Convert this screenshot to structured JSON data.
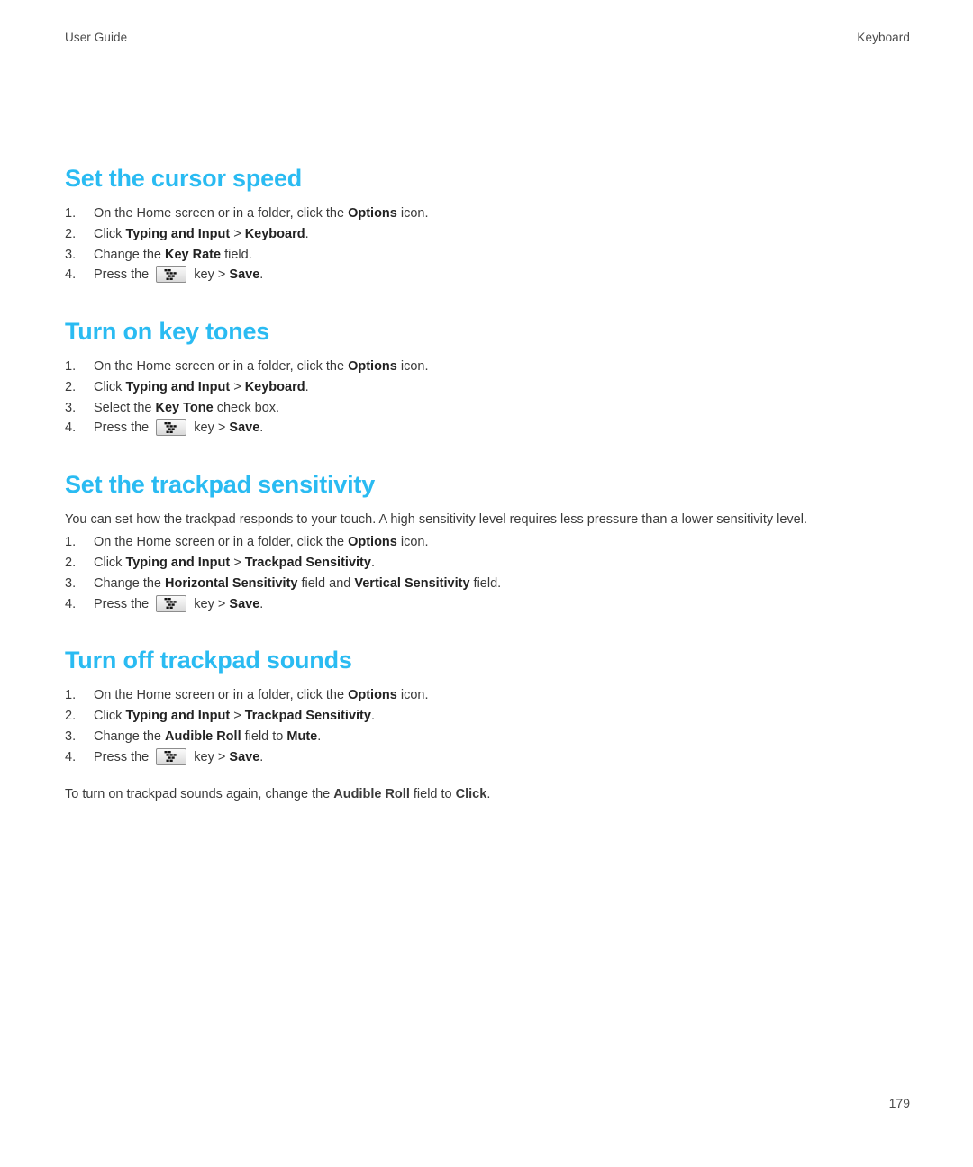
{
  "document": {
    "header": {
      "left": "User Guide",
      "right": "Keyboard"
    },
    "footer": {
      "page_number": "179"
    },
    "heading_color": "#2ABBF2",
    "key_icon_name": "blackberry-menu-key-icon"
  },
  "sections": [
    {
      "heading": "Set the cursor speed",
      "steps": [
        {
          "num": "1.",
          "parts": [
            {
              "t": "On the Home screen or in a folder, click the ",
              "b": false
            },
            {
              "t": "Options",
              "b": true
            },
            {
              "t": " icon.",
              "b": false
            }
          ]
        },
        {
          "num": "2.",
          "parts": [
            {
              "t": "Click ",
              "b": false
            },
            {
              "t": "Typing and Input",
              "b": true
            },
            {
              "t": " > ",
              "b": false
            },
            {
              "t": "Keyboard",
              "b": true
            },
            {
              "t": ".",
              "b": false
            }
          ]
        },
        {
          "num": "3.",
          "parts": [
            {
              "t": "Change the ",
              "b": false
            },
            {
              "t": "Key Rate",
              "b": true
            },
            {
              "t": " field.",
              "b": false
            }
          ]
        },
        {
          "num": "4.",
          "parts": [
            {
              "t": "Press the ",
              "b": false
            },
            {
              "icon": "blackberry-menu-key-icon"
            },
            {
              "t": " key > ",
              "b": false
            },
            {
              "t": "Save",
              "b": true
            },
            {
              "t": ".",
              "b": false
            }
          ]
        }
      ]
    },
    {
      "heading": "Turn on key tones",
      "steps": [
        {
          "num": "1.",
          "parts": [
            {
              "t": "On the Home screen or in a folder, click the ",
              "b": false
            },
            {
              "t": "Options",
              "b": true
            },
            {
              "t": " icon.",
              "b": false
            }
          ]
        },
        {
          "num": "2.",
          "parts": [
            {
              "t": "Click ",
              "b": false
            },
            {
              "t": "Typing and Input",
              "b": true
            },
            {
              "t": " > ",
              "b": false
            },
            {
              "t": "Keyboard",
              "b": true
            },
            {
              "t": ".",
              "b": false
            }
          ]
        },
        {
          "num": "3.",
          "parts": [
            {
              "t": "Select the ",
              "b": false
            },
            {
              "t": "Key Tone",
              "b": true
            },
            {
              "t": " check box.",
              "b": false
            }
          ]
        },
        {
          "num": "4.",
          "parts": [
            {
              "t": "Press the ",
              "b": false
            },
            {
              "icon": "blackberry-menu-key-icon"
            },
            {
              "t": " key > ",
              "b": false
            },
            {
              "t": "Save",
              "b": true
            },
            {
              "t": ".",
              "b": false
            }
          ]
        }
      ]
    },
    {
      "heading": "Set the trackpad sensitivity",
      "intro": "You can set how the trackpad responds to your touch. A high sensitivity level requires less pressure than a lower sensitivity level.",
      "steps": [
        {
          "num": "1.",
          "parts": [
            {
              "t": "On the Home screen or in a folder, click the ",
              "b": false
            },
            {
              "t": "Options",
              "b": true
            },
            {
              "t": " icon.",
              "b": false
            }
          ]
        },
        {
          "num": "2.",
          "parts": [
            {
              "t": "Click ",
              "b": false
            },
            {
              "t": "Typing and Input",
              "b": true
            },
            {
              "t": " > ",
              "b": false
            },
            {
              "t": "Trackpad Sensitivity",
              "b": true
            },
            {
              "t": ".",
              "b": false
            }
          ]
        },
        {
          "num": "3.",
          "parts": [
            {
              "t": "Change the ",
              "b": false
            },
            {
              "t": "Horizontal Sensitivity",
              "b": true
            },
            {
              "t": " field and ",
              "b": false
            },
            {
              "t": "Vertical Sensitivity",
              "b": true
            },
            {
              "t": " field.",
              "b": false
            }
          ]
        },
        {
          "num": "4.",
          "parts": [
            {
              "t": "Press the ",
              "b": false
            },
            {
              "icon": "blackberry-menu-key-icon"
            },
            {
              "t": " key > ",
              "b": false
            },
            {
              "t": "Save",
              "b": true
            },
            {
              "t": ".",
              "b": false
            }
          ]
        }
      ]
    },
    {
      "heading": "Turn off trackpad sounds",
      "steps": [
        {
          "num": "1.",
          "parts": [
            {
              "t": "On the Home screen or in a folder, click the ",
              "b": false
            },
            {
              "t": "Options",
              "b": true
            },
            {
              "t": " icon.",
              "b": false
            }
          ]
        },
        {
          "num": "2.",
          "parts": [
            {
              "t": "Click ",
              "b": false
            },
            {
              "t": "Typing and Input",
              "b": true
            },
            {
              "t": " > ",
              "b": false
            },
            {
              "t": "Trackpad Sensitivity",
              "b": true
            },
            {
              "t": ".",
              "b": false
            }
          ]
        },
        {
          "num": "3.",
          "parts": [
            {
              "t": "Change the ",
              "b": false
            },
            {
              "t": "Audible Roll",
              "b": true
            },
            {
              "t": " field to ",
              "b": false
            },
            {
              "t": "Mute",
              "b": true
            },
            {
              "t": ".",
              "b": false
            }
          ]
        },
        {
          "num": "4.",
          "parts": [
            {
              "t": "Press the ",
              "b": false
            },
            {
              "icon": "blackberry-menu-key-icon"
            },
            {
              "t": " key > ",
              "b": false
            },
            {
              "t": "Save",
              "b": true
            },
            {
              "t": ".",
              "b": false
            }
          ]
        }
      ],
      "outro_parts": [
        {
          "t": "To turn on trackpad sounds again, change the ",
          "b": false
        },
        {
          "t": "Audible Roll",
          "b": true
        },
        {
          "t": " field to ",
          "b": false
        },
        {
          "t": "Click",
          "b": true
        },
        {
          "t": ".",
          "b": false
        }
      ]
    }
  ]
}
